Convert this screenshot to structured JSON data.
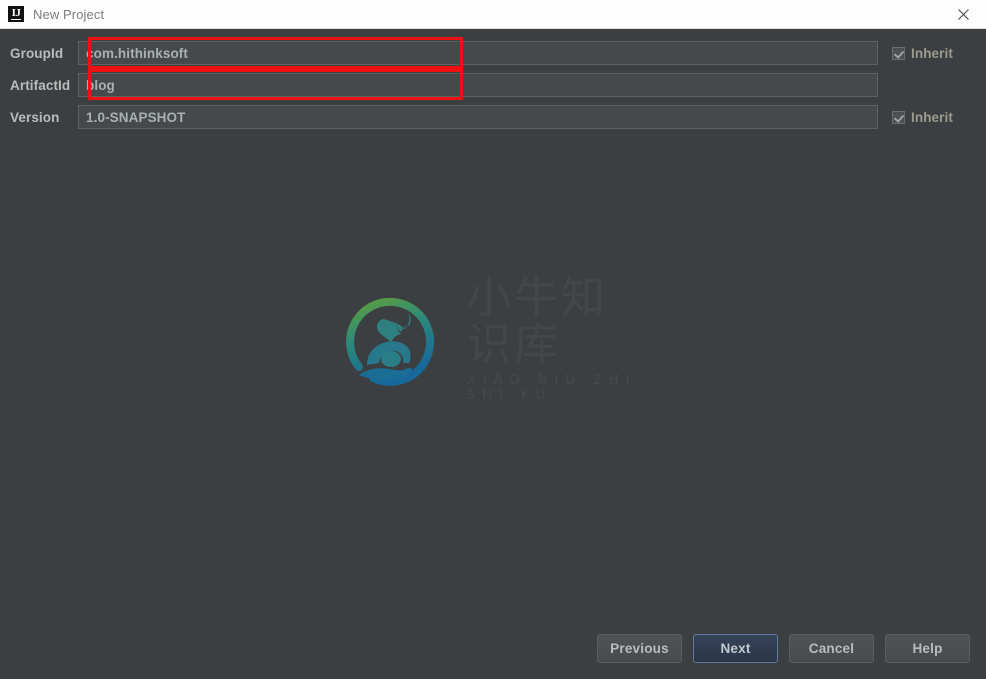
{
  "window": {
    "title": "New Project",
    "app_icon": "intellij-idea-icon",
    "close_icon": "close-icon"
  },
  "form": {
    "rows": [
      {
        "label": "GroupId",
        "value": "com.hithinksoft",
        "inherit_label": "Inherit",
        "inherit_checked": true,
        "highlighted": true
      },
      {
        "label": "ArtifactId",
        "value": "blog",
        "inherit_label": "",
        "inherit_checked": false,
        "highlighted": true
      },
      {
        "label": "Version",
        "value": "1.0-SNAPSHOT",
        "inherit_label": "Inherit",
        "inherit_checked": true,
        "highlighted": false
      }
    ]
  },
  "watermark": {
    "title_cn": "小牛知识库",
    "subtitle_en": "XIAO NIU ZHI SHI KU",
    "logo_icon": "ox-in-hand-circle-logo",
    "gradient_start": "#5a9e3e",
    "gradient_end": "#1a6e96"
  },
  "footer": {
    "buttons": [
      {
        "label": "Previous",
        "default": false
      },
      {
        "label": "Next",
        "default": true
      },
      {
        "label": "Cancel",
        "default": false
      },
      {
        "label": "Help",
        "default": false
      }
    ]
  },
  "colors": {
    "titlebar_bg": "#fdfdfd",
    "dialog_bg": "#3c3f41",
    "field_bg": "#45494a",
    "annotation_red": "#ee1111",
    "default_button_bg": "#2d3c52"
  }
}
